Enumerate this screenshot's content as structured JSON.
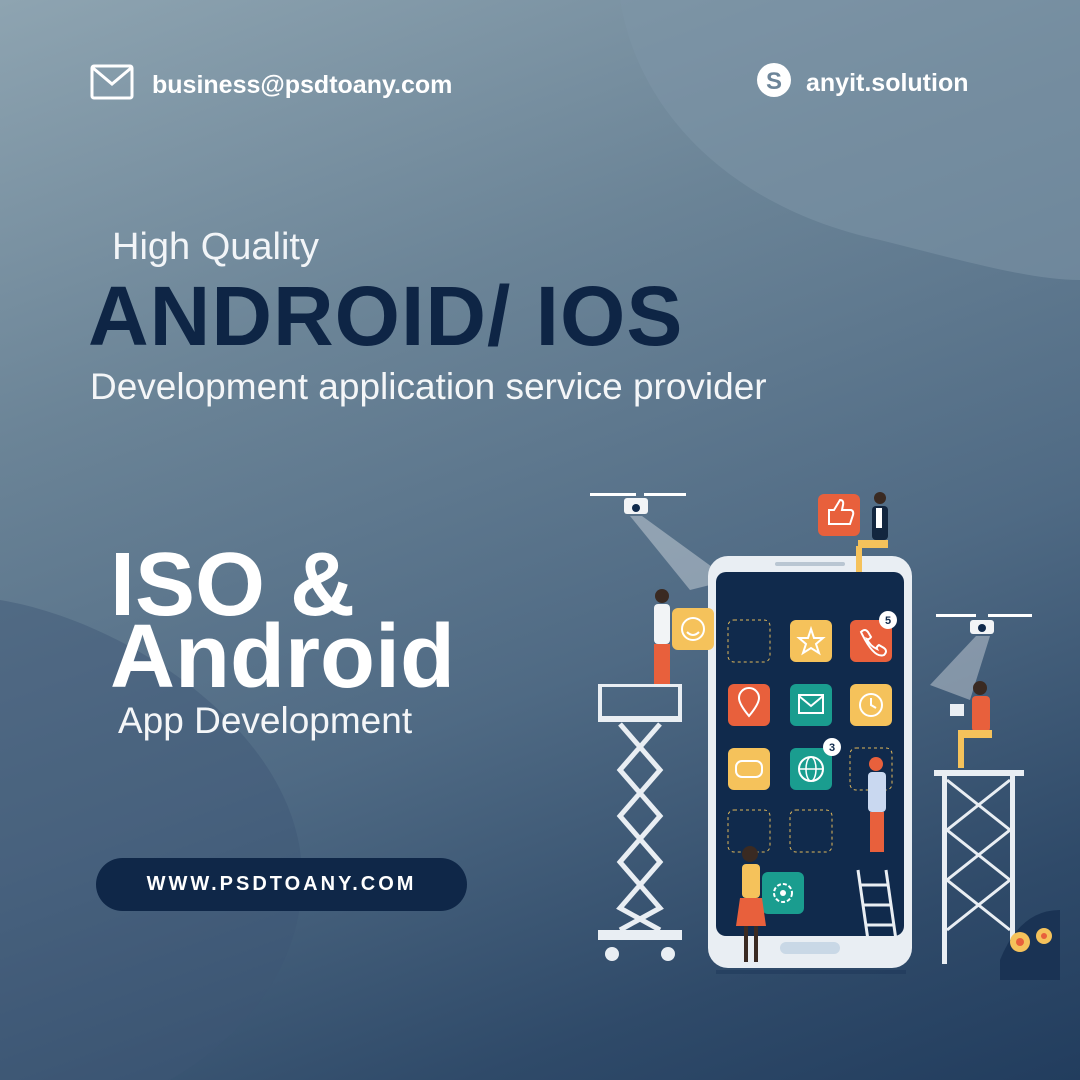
{
  "contact": {
    "email": "business@psdtoany.com",
    "skype": "anyit.solution",
    "email_icon": "mail-envelope-icon",
    "skype_icon": "skype-icon"
  },
  "hero": {
    "kicker": "High Quality",
    "headline": "ANDROID/ IOS",
    "subheadline": "Development application service provider"
  },
  "feature": {
    "line1": "ISO &",
    "line2": "Android",
    "caption": "App Development"
  },
  "cta": {
    "label": "WWW.PSDTOANY.COM"
  },
  "illustration": {
    "badges": [
      "5",
      "3"
    ],
    "app_icons": [
      "like-icon",
      "smile-icon",
      "star-icon",
      "phone-icon",
      "location-pin-icon",
      "mail-icon",
      "clock-icon",
      "gamepad-icon",
      "globe-icon",
      "settings-gear-icon"
    ]
  },
  "colors": {
    "headline": "#0e2545",
    "button": "#0f2748",
    "orange": "#e8603c",
    "yellow": "#f5c25b",
    "teal": "#1a9d8f",
    "phone_screen": "#102a4c"
  }
}
